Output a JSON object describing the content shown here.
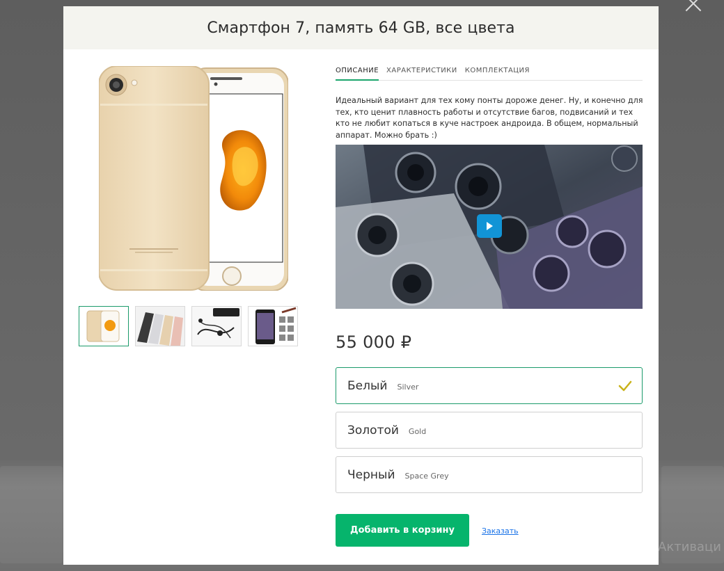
{
  "modal": {
    "title": "Смартфон 7, память 64 GB, все цвета"
  },
  "gallery": {
    "main_image": "gold-smartphone-front-back",
    "thumbnails": [
      {
        "name": "gold-phone-thumb",
        "active": true
      },
      {
        "name": "phone-colors-thumb",
        "active": false
      },
      {
        "name": "earphones-cable-thumb",
        "active": false
      },
      {
        "name": "phone-screens-thumb",
        "active": false
      }
    ]
  },
  "tabs": [
    {
      "label": "ОПИСАНИЕ",
      "active": true
    },
    {
      "label": "ХАРАКТЕРИСТИКИ",
      "active": false
    },
    {
      "label": "КОМПЛЕКТАЦИЯ",
      "active": false
    }
  ],
  "description": "Идеальный вариант для тех кому понты дороже денег. Ну, и конечно для тех, кто ценит плавность работы и отсутствие багов, подвисаний и тех кто не любит копаться в куче настроек андроида. В общем, нормальный аппарат. Можно брать :)",
  "video": {
    "play_icon": "play-icon"
  },
  "price": "55 000 ₽",
  "options": [
    {
      "name": "Белый",
      "sub": "Silver",
      "selected": true
    },
    {
      "name": "Золотой",
      "sub": "Gold",
      "selected": false
    },
    {
      "name": "Черный",
      "sub": "Space Grey",
      "selected": false
    }
  ],
  "actions": {
    "add_to_cart": "Добавить в корзину",
    "order": "Заказать"
  },
  "colors": {
    "accent_green": "#06b46c",
    "selected_border": "#1a9a6a",
    "check_yellow": "#c9b21a",
    "header_bg": "#f4f4ef",
    "link_blue": "#1a73e8",
    "play_blue": "#1294d6"
  }
}
